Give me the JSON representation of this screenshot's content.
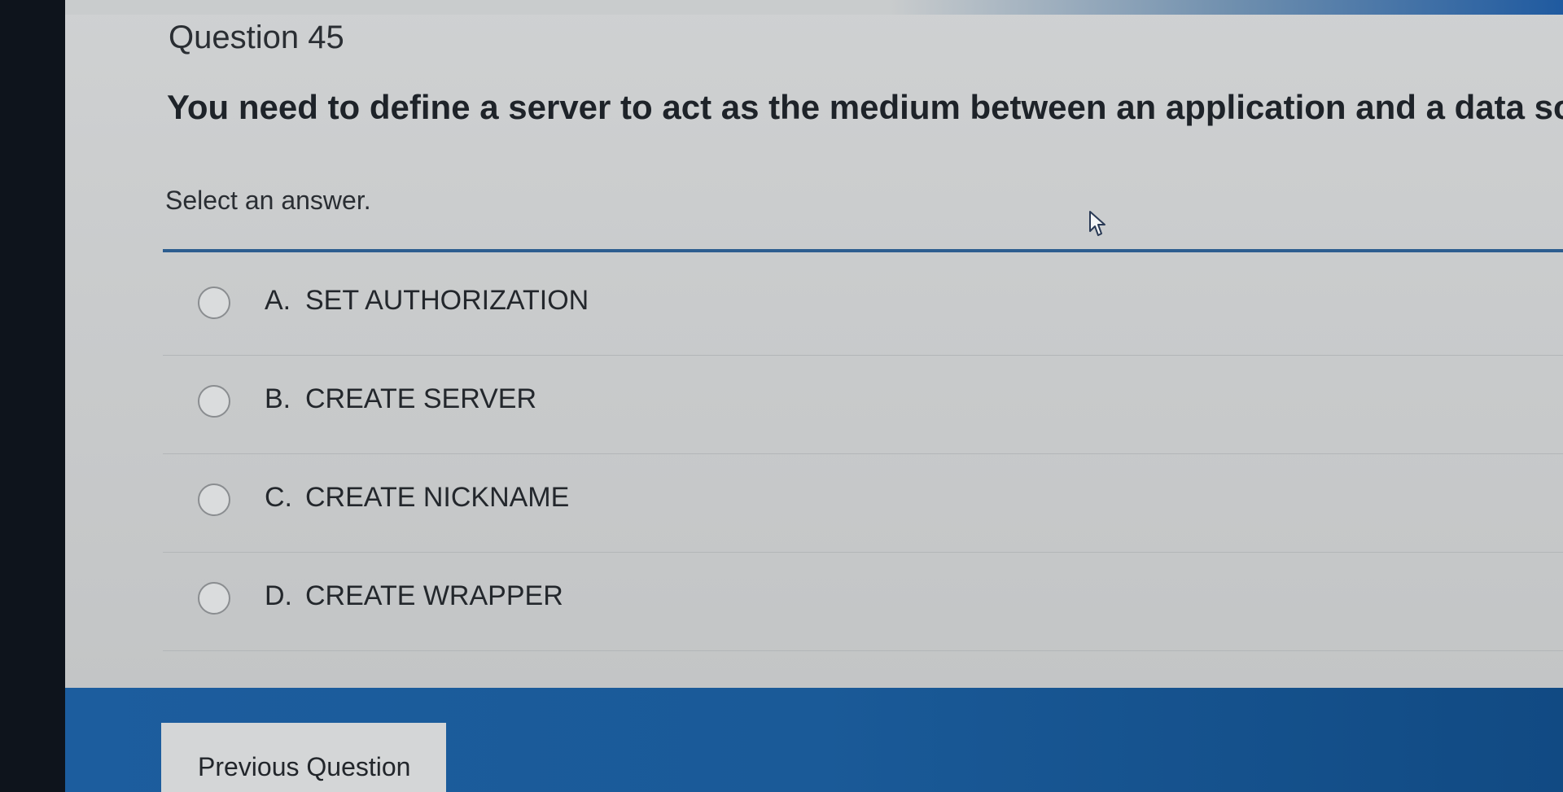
{
  "question": {
    "number_label": "Question 45",
    "text": "You need to define a server to act as the medium between an application and a data so",
    "instruction": "Select an answer."
  },
  "options": [
    {
      "letter": "A.",
      "label": "SET AUTHORIZATION"
    },
    {
      "letter": "B.",
      "label": "CREATE SERVER"
    },
    {
      "letter": "C.",
      "label": "CREATE NICKNAME"
    },
    {
      "letter": "D.",
      "label": "CREATE WRAPPER"
    }
  ],
  "footer": {
    "previous_label": "Previous Question"
  },
  "colors": {
    "panel": "#cfd1d2",
    "rule": "#2d5d8f",
    "footer": "#1c5d9e",
    "bezel": "#0e141c"
  },
  "icons": {
    "cursor": "mouse-pointer-icon",
    "radio": "radio-unchecked-icon"
  }
}
